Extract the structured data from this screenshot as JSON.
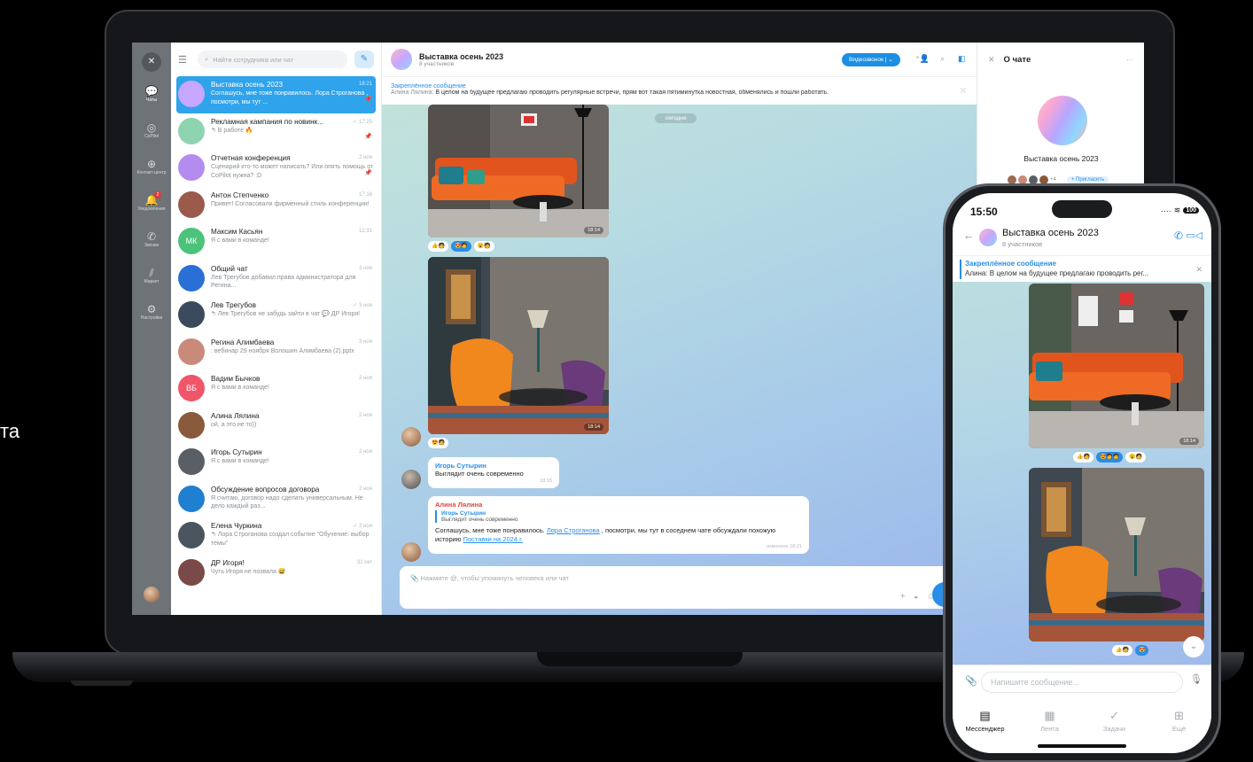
{
  "side_text": "та",
  "desktop": {
    "rail": [
      {
        "label": "Чаты",
        "icon": "chat-icon",
        "active": true
      },
      {
        "label": "CoPilot",
        "icon": "copilot-icon"
      },
      {
        "label": "Контакт-центр",
        "icon": "contact-center-icon"
      },
      {
        "label": "Уведомления",
        "icon": "bell-icon",
        "badge": "2"
      },
      {
        "label": "Звонки",
        "icon": "phone-icon"
      },
      {
        "label": "Маркет",
        "icon": "market-icon"
      },
      {
        "label": "Настройки",
        "icon": "gear-icon"
      }
    ],
    "search_placeholder": "Найти сотрудника или чат",
    "chats": [
      {
        "name": "Выставка осень 2023",
        "preview": "Соглашусь, мне тоже понравилось. Лора Строганова , посмотри, мы тут ...",
        "time": "18:21",
        "pinned": true,
        "active": true,
        "avatar_color": "#c7a7ff"
      },
      {
        "name": "Рекламная кампания по новинк...",
        "preview": "↰ В работе 🔥",
        "time": "✓ 17:25",
        "pinned": true,
        "avatar_color": "#8fd4b0"
      },
      {
        "name": "Отчетная конференция",
        "preview": "Сценарий кто-то может написать? Или опять помощь от CoPilot нужна? :D",
        "time": "2 ноя",
        "pinned": true,
        "avatar_color": "#b48cf0"
      },
      {
        "name": "Антон Степченко",
        "preview": "Привет! Согласовали фирменный стиль конференции!",
        "time": "17:16",
        "avatar_color": "#9a5a4c"
      },
      {
        "name": "Максим Касьян",
        "preview": "Я с вами в команде!",
        "time": "12:31",
        "avatar_text": "МК",
        "avatar_color": "#4cc37a"
      },
      {
        "name": "Общий чат",
        "preview": "Лев Трегубов добавил права администратора для Регина...",
        "time": "3 ноя",
        "avatar_color": "#2a6fd6"
      },
      {
        "name": "Лев Трегубов",
        "preview": "↰ Лев Трегубов не забудь зайти в чат 💬 ДР Игоря!",
        "time": "✓ 3 ноя",
        "avatar_color": "#3b4a5c"
      },
      {
        "name": "Регина Алимбаева",
        "preview": ": вебинар 29 ноября Волошин Алимбаева (2).pptx",
        "time": "3 ноя",
        "avatar_color": "#c98a7a"
      },
      {
        "name": "Вадим Бычков",
        "preview": "Я с вами в команде!",
        "time": "2 ноя",
        "avatar_text": "ВБ",
        "avatar_color": "#f0556a"
      },
      {
        "name": "Алина Лялина",
        "preview": "ой, а это не то))",
        "time": "2 ноя",
        "avatar_color": "#8a5a3c"
      },
      {
        "name": "Игорь Сутырин",
        "preview": "Я с вами в команде!",
        "time": "2 ноя",
        "avatar_color": "#5a5f66"
      },
      {
        "name": "Обсуждение вопросов договора",
        "preview": "Я считаю, договор надо сделать универсальным. Не дело каждый раз...",
        "time": "2 ноя",
        "avatar_color": "#1f7fd1"
      },
      {
        "name": "Елена Чуркина",
        "preview": "↰ Лора Строганова создал событие \"Обучение: выбор темы\"",
        "time": "✓ 2 ноя",
        "avatar_color": "#4a5560"
      },
      {
        "name": "ДР Игоря!",
        "preview": "Чуть Игоря не позвала 😅",
        "time": "31 окт",
        "avatar_color": "#7a4a4a"
      }
    ],
    "chat": {
      "title": "Выставка осень 2023",
      "subtitle": "8 участников",
      "video_button": "Видеозвонок",
      "pinned_title": "Закреплённое сообщение",
      "pinned_author": "Алина Лялина:",
      "pinned_text": "В целом на будущее предлагаю проводить регулярные встречи, прям вот такая пятиминутка новостная, обменялись и пошли работать.",
      "date_chip": "сегодня",
      "img1_time": "18:14",
      "img2_time": "18:14",
      "reply_author": "Игорь Сутырин",
      "reply_text": "Выглядит очень современно",
      "reply_time": "18:15",
      "last_author": "Алина Лялина",
      "last_quote_author": "Игорь Сутырин",
      "last_quote_text": "Выглядит очень современно",
      "last_text_1": "Соглашусь, мне тоже понравилось.",
      "last_link_1": "Лора Строганова",
      "last_text_2": ", посмотри, мы тут в соседнем чате обсуждали похожую историю",
      "last_link_2": "Поставки на 2024 г.",
      "last_time": "изменено 18:21",
      "composer_placeholder": "Нажмите @, чтобы упомянуть человека или чат"
    },
    "info": {
      "title": "О чате",
      "name": "Выставка осень 2023",
      "members_more": "+4",
      "invite": "+ Пригласить"
    }
  },
  "phone": {
    "time": "15:50",
    "battery": "100",
    "title": "Выставка осень 2023",
    "subtitle": "8 участников",
    "pinned_title": "Закреплённое сообщение",
    "pinned_text": "Алина: В целом на будущее предлагаю проводить рег...",
    "img_time": "18:14",
    "input_placeholder": "Напишите сообщение...",
    "tabs": [
      {
        "label": "Мессенджер",
        "icon": "messenger-icon",
        "active": true
      },
      {
        "label": "Лента",
        "icon": "feed-icon"
      },
      {
        "label": "Задачи",
        "icon": "tasks-icon"
      },
      {
        "label": "Ещё",
        "icon": "more-icon"
      }
    ]
  }
}
